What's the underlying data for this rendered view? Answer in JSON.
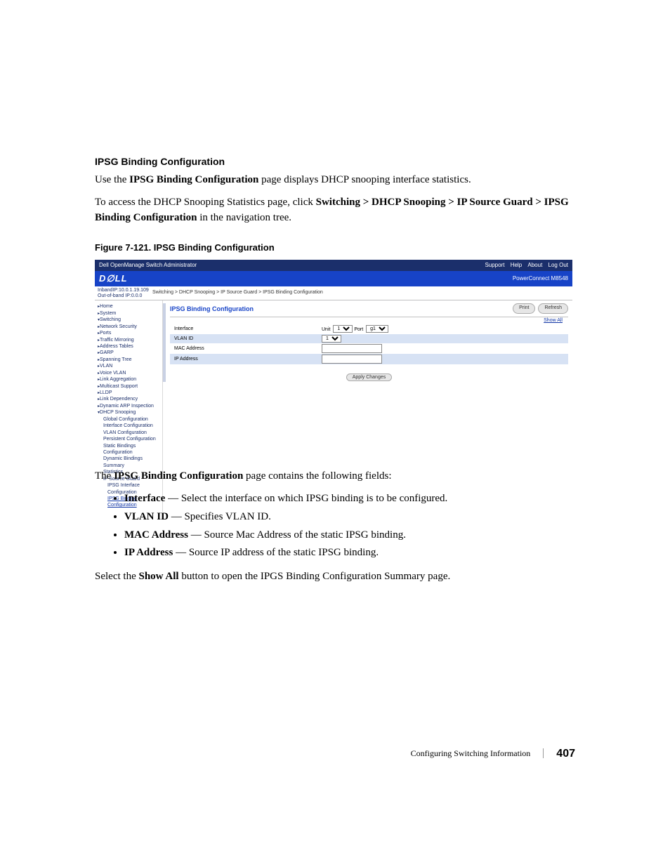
{
  "section": {
    "heading": "IPSG Binding Configuration",
    "intro_pre": "Use the ",
    "intro_bold": "IPSG Binding Configuration",
    "intro_post": " page displays DHCP snooping interface statistics.",
    "access_pre": "To access the DHCP Snooping Statistics page, click ",
    "access_bold": "Switching > DHCP Snooping > IP Source Guard > IPSG Binding Configuration",
    "access_post": " in the navigation tree.",
    "figure_caption": "Figure 7-121.    IPSG Binding Configuration",
    "after_fig_pre": "The ",
    "after_fig_bold": "IPSG Binding Configuration",
    "after_fig_post": " page contains the following fields:",
    "bullets": [
      {
        "term": "Interface",
        "desc": " — Select the interface on which IPSG binding is to be configured."
      },
      {
        "term": "VLAN ID",
        "desc": " — Specifies VLAN ID."
      },
      {
        "term": "MAC Address",
        "desc": " — Source Mac Address of the static IPSG binding."
      },
      {
        "term": "IP Address",
        "desc": " — Source IP address of the static IPSG binding."
      }
    ],
    "closing_pre": "Select the ",
    "closing_bold": "Show All",
    "closing_post": " button to open the IPGS Binding Configuration Summary page."
  },
  "screenshot": {
    "window_title": "Dell OpenManage Switch Administrator",
    "top_links": [
      "Support",
      "Help",
      "About",
      "Log Out"
    ],
    "brand": "D∅LL",
    "model": "PowerConnect M8548",
    "ident_line1": "InbandIP:10.0.1.19.109",
    "ident_line2": "Out-of-band IP:0.0.0",
    "breadcrumb": "Switching > DHCP Snooping > IP Source Guard > IPSG Binding Configuration",
    "nav": [
      {
        "label": "Home",
        "cls": "n1"
      },
      {
        "label": "System",
        "cls": "n1"
      },
      {
        "label": "Switching",
        "cls": "n1 exp"
      },
      {
        "label": "Network Security",
        "cls": "n1"
      },
      {
        "label": "Ports",
        "cls": "n1"
      },
      {
        "label": "Traffic Mirroring",
        "cls": "n1"
      },
      {
        "label": "Address Tables",
        "cls": "n1"
      },
      {
        "label": "GARP",
        "cls": "n1"
      },
      {
        "label": "Spanning Tree",
        "cls": "n1"
      },
      {
        "label": "VLAN",
        "cls": "n1"
      },
      {
        "label": "Voice VLAN",
        "cls": "n1"
      },
      {
        "label": "Link Aggregation",
        "cls": "n1"
      },
      {
        "label": "Multicast Support",
        "cls": "n1"
      },
      {
        "label": "LLDP",
        "cls": "n1"
      },
      {
        "label": "Link Dependency",
        "cls": "n1"
      },
      {
        "label": "Dynamic ARP Inspection",
        "cls": "n1"
      },
      {
        "label": "DHCP Snooping",
        "cls": "n1 exp"
      },
      {
        "label": "Global Configuration",
        "cls": "n2"
      },
      {
        "label": "Interface Configuration",
        "cls": "n2"
      },
      {
        "label": "VLAN Configuration",
        "cls": "n2"
      },
      {
        "label": "Persistent Configuration",
        "cls": "n2"
      },
      {
        "label": "Static Bindings Configuration",
        "cls": "n2"
      },
      {
        "label": "Dynamic Bindings Summary",
        "cls": "n2"
      },
      {
        "label": "Statistics",
        "cls": "n2"
      },
      {
        "label": "IP Source Guard",
        "cls": "n2 exp"
      },
      {
        "label": "IPSG Interface Configuration",
        "cls": "n3"
      },
      {
        "label": "IPSG Binding Configuration",
        "cls": "n3 sel"
      }
    ],
    "main_heading": "IPSG Binding Configuration",
    "buttons": {
      "print": "Print",
      "refresh": "Refresh",
      "show_all": "Show All",
      "apply": "Apply Changes"
    },
    "form": {
      "rows": [
        {
          "label": "Interface",
          "type": "interface"
        },
        {
          "label": "VLAN ID",
          "type": "vlan"
        },
        {
          "label": "MAC Address",
          "type": "text"
        },
        {
          "label": "IP Address",
          "type": "text"
        }
      ],
      "interface": {
        "unit_label": "Unit",
        "unit_value": "1",
        "port_label": "Port",
        "port_value": "g1"
      },
      "vlan_value": "1"
    }
  },
  "footer": {
    "text": "Configuring Switching Information",
    "page": "407"
  }
}
